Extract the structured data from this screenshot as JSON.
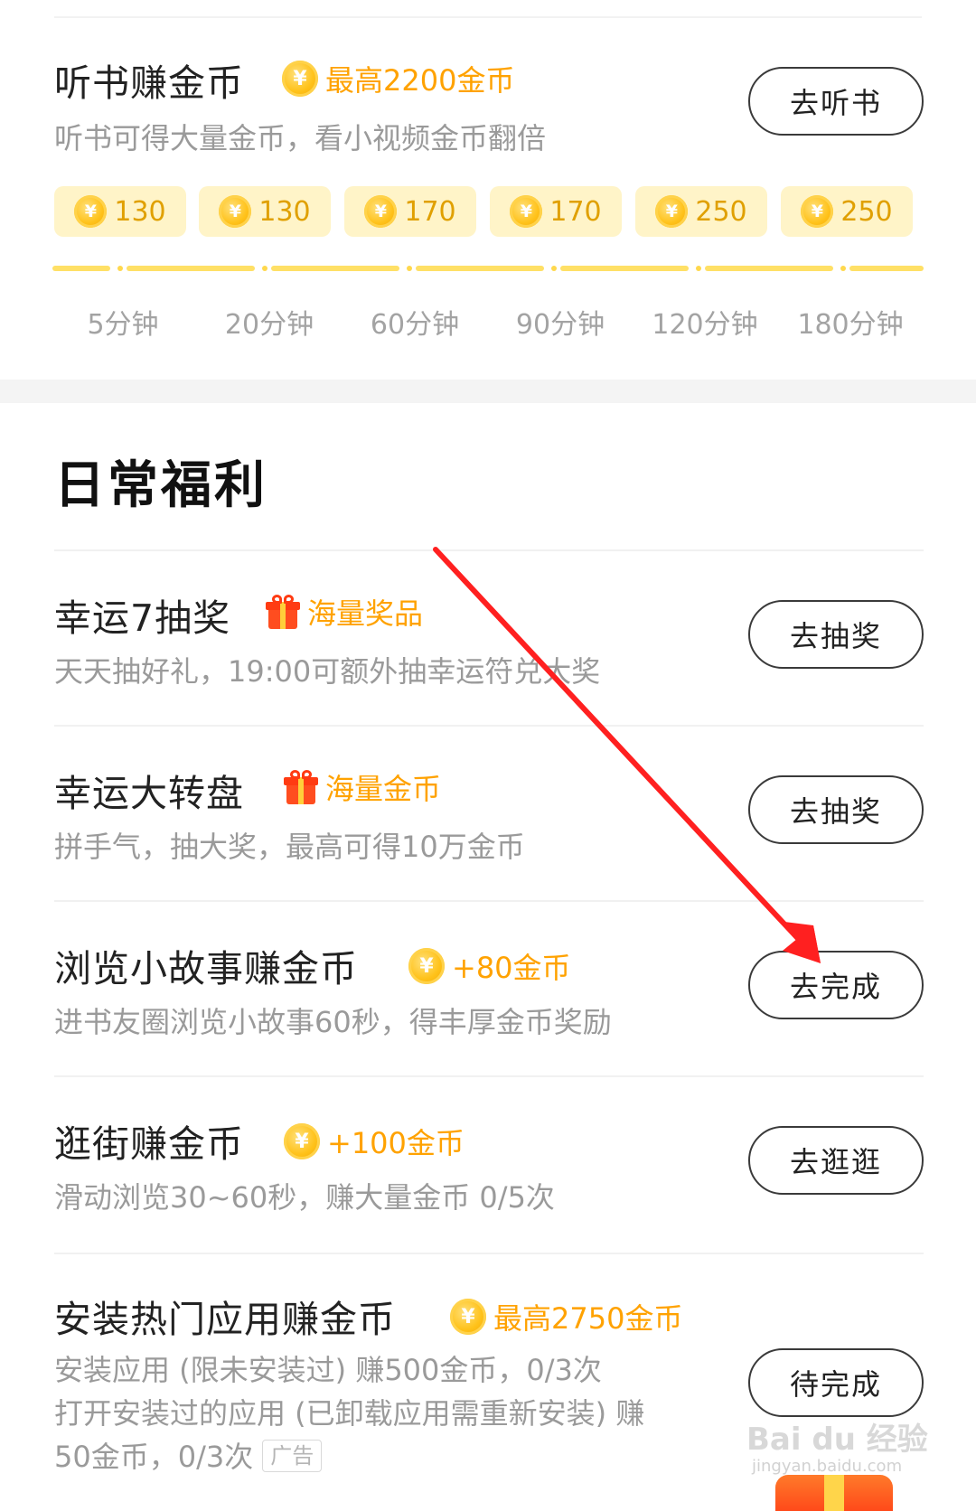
{
  "listen_task": {
    "title": "听书赚金币",
    "reward": "最高2200金币",
    "desc": "听书可得大量金币，看小视频金币翻倍",
    "button": "去听书",
    "chips": [
      {
        "amount": "130"
      },
      {
        "amount": "130"
      },
      {
        "amount": "170"
      },
      {
        "amount": "170"
      },
      {
        "amount": "250"
      },
      {
        "amount": "250"
      }
    ],
    "times": [
      "5分钟",
      "20分钟",
      "60分钟",
      "90分钟",
      "120分钟",
      "180分钟"
    ]
  },
  "daily": {
    "section_title": "日常福利",
    "tasks": [
      {
        "title": "幸运7抽奖",
        "reward": "海量奖品",
        "reward_icon": "gift-icon",
        "desc": "天天抽好礼，19:00可额外抽幸运符兑大奖",
        "button": "去抽奖"
      },
      {
        "title": "幸运大转盘",
        "reward": "海量金币",
        "reward_icon": "gift-icon",
        "desc": "拼手气，抽大奖，最高可得10万金币",
        "button": "去抽奖"
      },
      {
        "title": "浏览小故事赚金币",
        "reward": "+80金币",
        "reward_icon": "coin-icon",
        "desc": "进书友圈浏览小故事60秒，得丰厚金币奖励",
        "button": "去完成"
      },
      {
        "title": "逛街赚金币",
        "reward": "+100金币",
        "reward_icon": "coin-icon",
        "desc": "滑动浏览30~60秒，赚大量金币 0/5次",
        "button": "去逛逛"
      },
      {
        "title": "安装热门应用赚金币",
        "reward": "最高2750金币",
        "reward_icon": "coin-icon",
        "desc_line1": "安装应用 (限未安装过) 赚500金币，0/3次",
        "desc_line2": "打开安装过的应用 (已卸载应用需重新安装) 赚",
        "desc_line3": "50金币，0/3次",
        "ad_tag": "广告",
        "button": "待完成"
      }
    ]
  },
  "coin_symbol": "¥",
  "watermark": {
    "main": "Bai du 经验",
    "sub": "jingyan.baidu.com"
  },
  "colors": {
    "accent": "#ffa200",
    "chip_bg": "#fff4c8",
    "progress": "#ffe066",
    "arrow": "#ff2020"
  }
}
